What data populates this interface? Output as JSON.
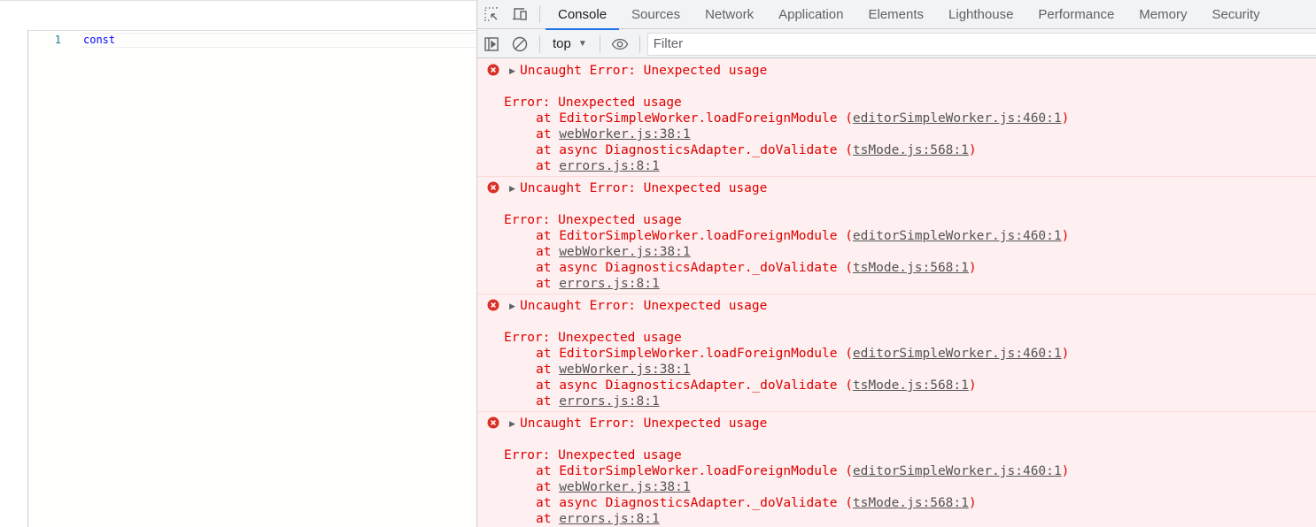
{
  "editor": {
    "lines": [
      {
        "number": "1",
        "code": "const"
      }
    ],
    "colors": {
      "keyword": "#0000ff",
      "line_number": "#237893"
    }
  },
  "devtools": {
    "tabs": [
      {
        "label": "Console",
        "active": true
      },
      {
        "label": "Sources"
      },
      {
        "label": "Network"
      },
      {
        "label": "Application"
      },
      {
        "label": "Elements"
      },
      {
        "label": "Lighthouse"
      },
      {
        "label": "Performance"
      },
      {
        "label": "Memory"
      },
      {
        "label": "Security"
      }
    ],
    "toolbar": {
      "context": "top",
      "filter_placeholder": "Filter",
      "filter_value": ""
    },
    "colors": {
      "error_text": "#e00000",
      "error_bg": "#fef0f0",
      "accent": "#1a73e8",
      "link": "#545454"
    },
    "messages": [
      {
        "summary": "Uncaught Error: Unexpected usage",
        "error": "Error: Unexpected usage",
        "stack": [
          {
            "prefix": "at EditorSimpleWorker.loadForeignModule (",
            "link": "editorSimpleWorker.js:460:1",
            "suffix": ")"
          },
          {
            "prefix": "at ",
            "link": "webWorker.js:38:1",
            "suffix": ""
          },
          {
            "prefix": "at async DiagnosticsAdapter._doValidate (",
            "link": "tsMode.js:568:1",
            "suffix": ")"
          },
          {
            "prefix": "at ",
            "link": "errors.js:8:1",
            "suffix": ""
          }
        ]
      },
      {
        "summary": "Uncaught Error: Unexpected usage",
        "error": "Error: Unexpected usage",
        "stack": [
          {
            "prefix": "at EditorSimpleWorker.loadForeignModule (",
            "link": "editorSimpleWorker.js:460:1",
            "suffix": ")"
          },
          {
            "prefix": "at ",
            "link": "webWorker.js:38:1",
            "suffix": ""
          },
          {
            "prefix": "at async DiagnosticsAdapter._doValidate (",
            "link": "tsMode.js:568:1",
            "suffix": ")"
          },
          {
            "prefix": "at ",
            "link": "errors.js:8:1",
            "suffix": ""
          }
        ]
      },
      {
        "summary": "Uncaught Error: Unexpected usage",
        "error": "Error: Unexpected usage",
        "stack": [
          {
            "prefix": "at EditorSimpleWorker.loadForeignModule (",
            "link": "editorSimpleWorker.js:460:1",
            "suffix": ")"
          },
          {
            "prefix": "at ",
            "link": "webWorker.js:38:1",
            "suffix": ""
          },
          {
            "prefix": "at async DiagnosticsAdapter._doValidate (",
            "link": "tsMode.js:568:1",
            "suffix": ")"
          },
          {
            "prefix": "at ",
            "link": "errors.js:8:1",
            "suffix": ""
          }
        ]
      },
      {
        "summary": "Uncaught Error: Unexpected usage",
        "error": "Error: Unexpected usage",
        "stack": [
          {
            "prefix": "at EditorSimpleWorker.loadForeignModule (",
            "link": "editorSimpleWorker.js:460:1",
            "suffix": ")"
          },
          {
            "prefix": "at ",
            "link": "webWorker.js:38:1",
            "suffix": ""
          },
          {
            "prefix": "at async DiagnosticsAdapter._doValidate (",
            "link": "tsMode.js:568:1",
            "suffix": ")"
          },
          {
            "prefix": "at ",
            "link": "errors.js:8:1",
            "suffix": ""
          }
        ]
      }
    ]
  }
}
